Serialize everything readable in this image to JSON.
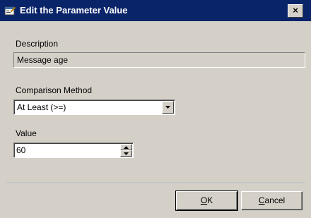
{
  "window": {
    "title": "Edit the Parameter Value",
    "close_label": "×",
    "icon": "dialog-app-icon"
  },
  "description": {
    "label": "Description",
    "value": "Message age"
  },
  "comparison": {
    "label": "Comparison Method",
    "selected": "At Least (>=)"
  },
  "value_field": {
    "label": "Value",
    "value": "60"
  },
  "buttons": {
    "ok_mnemonic": "O",
    "ok_rest": "K",
    "cancel_mnemonic": "C",
    "cancel_rest": "ancel"
  },
  "colors": {
    "titlebar": "#0a246a",
    "window_bg": "#d4d0c8"
  }
}
